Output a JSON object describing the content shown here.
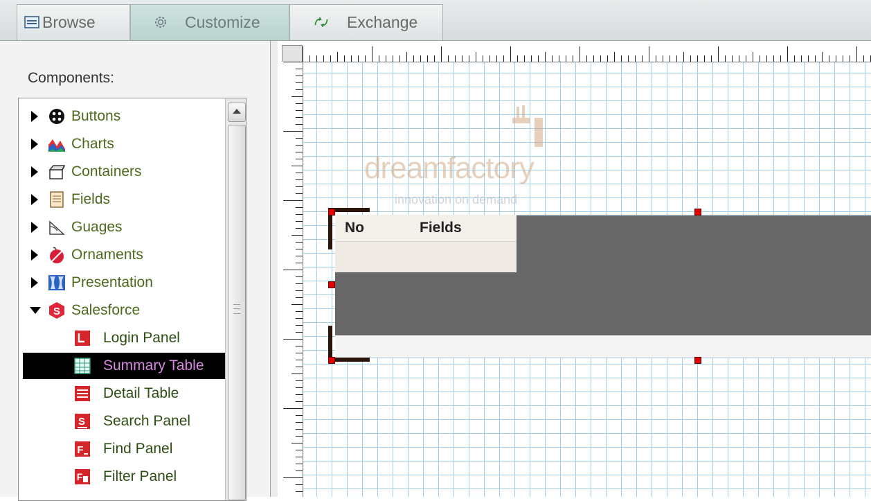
{
  "tabs": [
    {
      "label": "Browse",
      "icon": "window-icon",
      "active": false
    },
    {
      "label": "Customize",
      "icon": "gear-icon",
      "active": true
    },
    {
      "label": "Exchange",
      "icon": "exchange-arrows-icon",
      "active": false
    }
  ],
  "left_panel": {
    "title": "Components:",
    "categories": [
      {
        "label": "Buttons",
        "icon": "buttons-icon",
        "expanded": false
      },
      {
        "label": "Charts",
        "icon": "charts-icon",
        "expanded": false
      },
      {
        "label": "Containers",
        "icon": "containers-icon",
        "expanded": false
      },
      {
        "label": "Fields",
        "icon": "fields-icon",
        "expanded": false
      },
      {
        "label": "Guages",
        "icon": "gauges-icon",
        "expanded": false
      },
      {
        "label": "Ornaments",
        "icon": "ornaments-icon",
        "expanded": false
      },
      {
        "label": "Presentation",
        "icon": "presentation-icon",
        "expanded": false
      },
      {
        "label": "Salesforce",
        "icon": "salesforce-icon",
        "expanded": true
      }
    ],
    "salesforce_items": [
      {
        "label": "Login Panel",
        "icon": "login-panel-icon",
        "selected": false
      },
      {
        "label": "Summary Table",
        "icon": "summary-table-icon",
        "selected": true
      },
      {
        "label": "Detail Table",
        "icon": "detail-table-icon",
        "selected": false
      },
      {
        "label": "Search Panel",
        "icon": "search-panel-icon",
        "selected": false
      },
      {
        "label": "Find Panel",
        "icon": "find-panel-icon",
        "selected": false
      },
      {
        "label": "Filter Panel",
        "icon": "filter-panel-icon",
        "selected": false
      }
    ]
  },
  "canvas": {
    "watermark": {
      "brand": "dreamfactory",
      "tagline": "innovation on demand"
    },
    "summary_table": {
      "columns": [
        "No",
        "Fields"
      ]
    }
  },
  "colors": {
    "tab_active": "#b9d3cd",
    "grid_line": "#9fd0ee",
    "selection_handle": "#e00000",
    "tree_text": "#4d6a1c",
    "selected_text": "#d78be0",
    "component_fill": "#676767"
  }
}
